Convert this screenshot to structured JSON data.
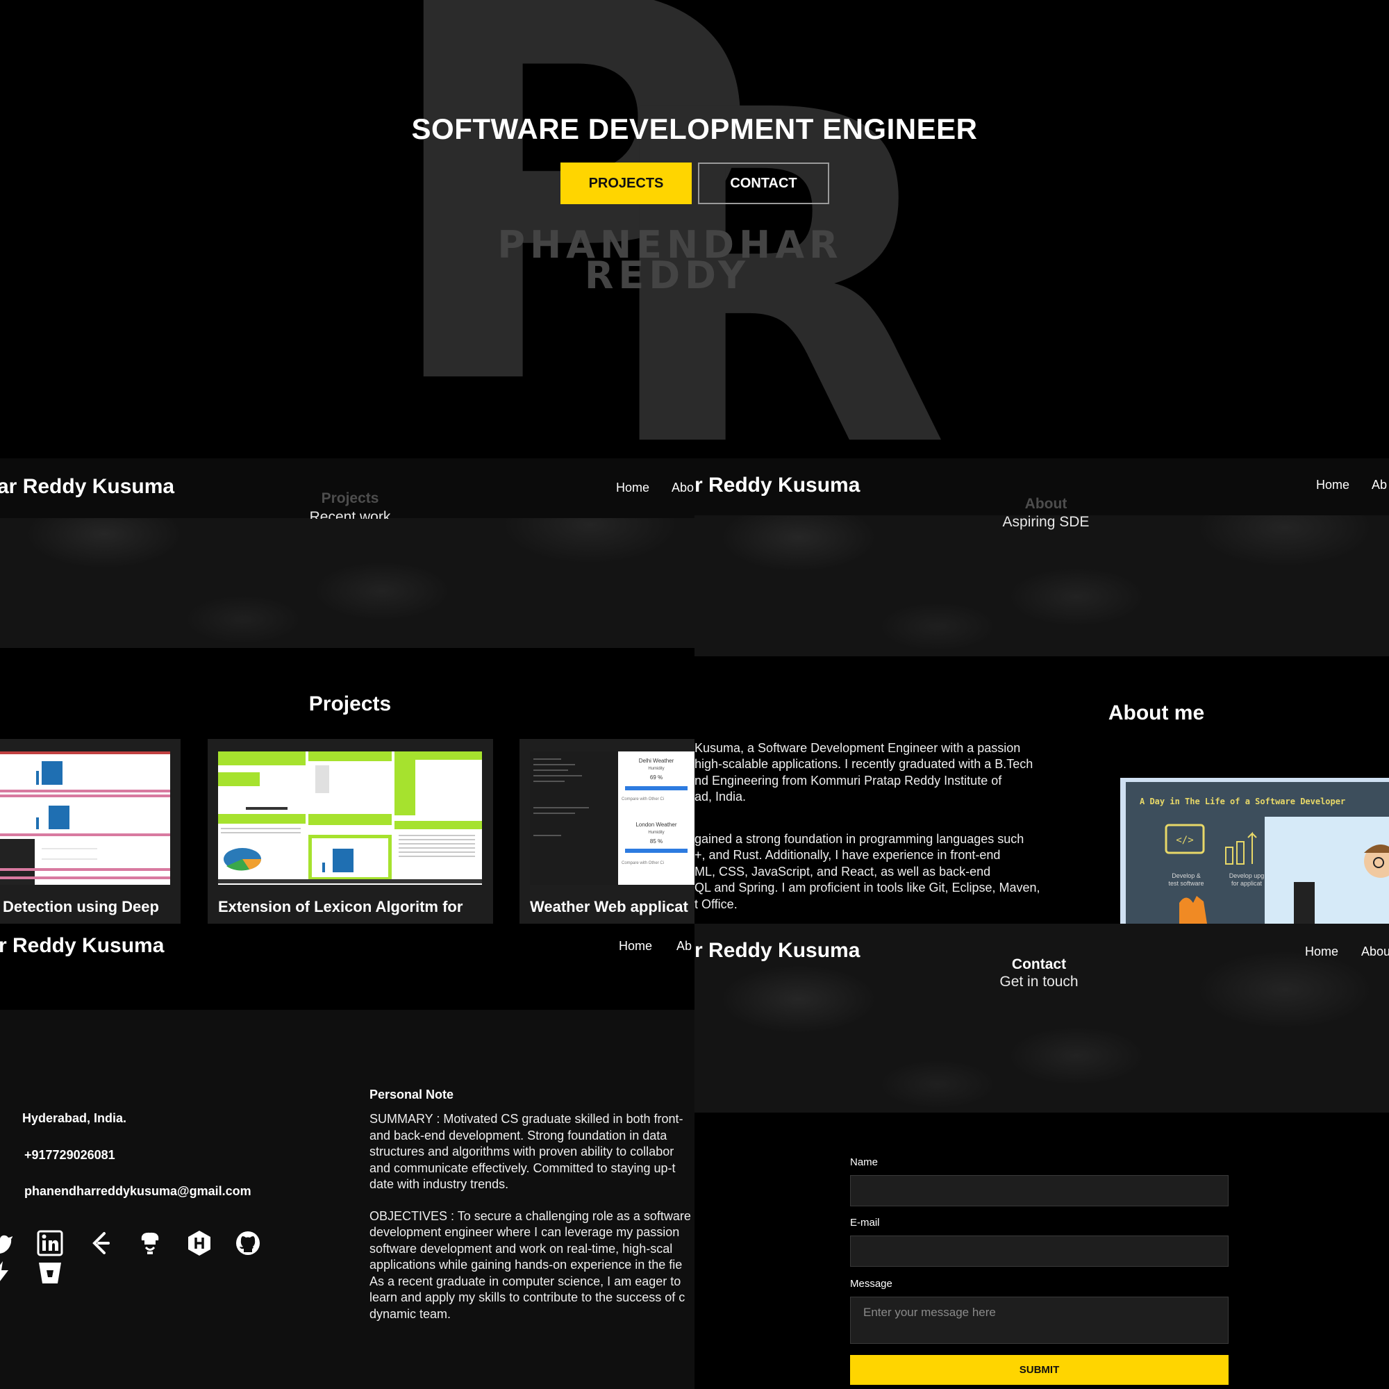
{
  "hero": {
    "monogram_left": "P",
    "monogram_right": "R",
    "title": "SOFTWARE DEVELOPMENT ENGINEER",
    "projects_button": "PROJECTS",
    "contact_button": "CONTACT",
    "wordmark_line1": "PHANENDHAR",
    "wordmark_line2": "REDDY"
  },
  "projects_page": {
    "brand": "ar Reddy Kusuma",
    "nav_home": "Home",
    "nav_about": "Abo",
    "banner_title": "Projects",
    "banner_subtitle": "Recent work",
    "section_heading": "Projects",
    "cards": [
      {
        "title": "Detection using Deep"
      },
      {
        "title": "Extension of Lexicon Algoritm for"
      },
      {
        "title": "Weather Web applicat"
      }
    ],
    "weather_thumb": {
      "city1": "Delhi Weather",
      "humidity_label": "Humidity",
      "value1": "69 %",
      "city2": "London Weather",
      "value2": "85 %",
      "compare_label": "Compare with Other Ci"
    }
  },
  "about_page": {
    "brand": "r Reddy Kusuma",
    "nav_home": "Home",
    "nav_about": "Ab",
    "banner_title": "About",
    "banner_subtitle": "Aspiring SDE",
    "section_heading": "About me",
    "paragraph1": [
      " Kusuma, a Software Development Engineer with a passion",
      " high-scalable applications. I recently graduated with a B.Tech",
      "nd Engineering from Kommuri Pratap Reddy Institute of",
      "ad, India."
    ],
    "paragraph2": [
      "gained a strong foundation in programming languages such",
      "+, and Rust. Additionally, I have experience in front-end",
      "ML, CSS, JavaScript, and React, as well as back-end",
      "QL and Spring. I am proficient in tools like Git, Eclipse, Maven,",
      "t Office."
    ],
    "illustration": {
      "title": "A Day in The Life of a Software Developer",
      "caption1a": "Develop &",
      "caption1b": "test software",
      "caption2a": "Develop upg",
      "caption2b": "for applicat"
    }
  },
  "info_page": {
    "brand": "r Reddy Kusuma",
    "nav_home": "Home",
    "nav_about": "Ab",
    "location": "Hyderabad, India.",
    "phone": "+917729026081",
    "email": "phanendharreddykusuma@gmail.com",
    "note_heading": "Personal Note",
    "summary": [
      "SUMMARY : Motivated CS graduate skilled in both front-",
      "and back-end development. Strong foundation in data",
      "structures and algorithms with proven ability to collabor",
      "and communicate effectively. Committed to staying up-t",
      "date with industry trends."
    ],
    "objectives": [
      "OBJECTIVES : To secure a challenging role as a software",
      "development engineer where I can leverage my passion",
      "software development and work on real-time, high-scal",
      "applications while gaining hands-on experience in the fie",
      "As a recent graduate in computer science, I am eager to",
      "learn and apply my skills to contribute to the success of c",
      "dynamic team."
    ],
    "socials": [
      "twitter-icon",
      "linkedin-icon",
      "leetcode-icon",
      "codechef-icon",
      "hackerrank-icon",
      "github-icon",
      "gfg-icon",
      "bitbucket-icon"
    ]
  },
  "contact_page": {
    "brand": "r Reddy Kusuma",
    "nav_home": "Home",
    "nav_about": "Abou",
    "banner_title": "Contact",
    "banner_subtitle": "Get in touch",
    "name_label": "Name",
    "email_label": "E-mail",
    "message_label": "Message",
    "message_placeholder": "Enter your message here",
    "submit_button": "SUBMIT"
  },
  "colors": {
    "accent": "#ffd500",
    "background": "#000000",
    "panel": "#141414"
  }
}
